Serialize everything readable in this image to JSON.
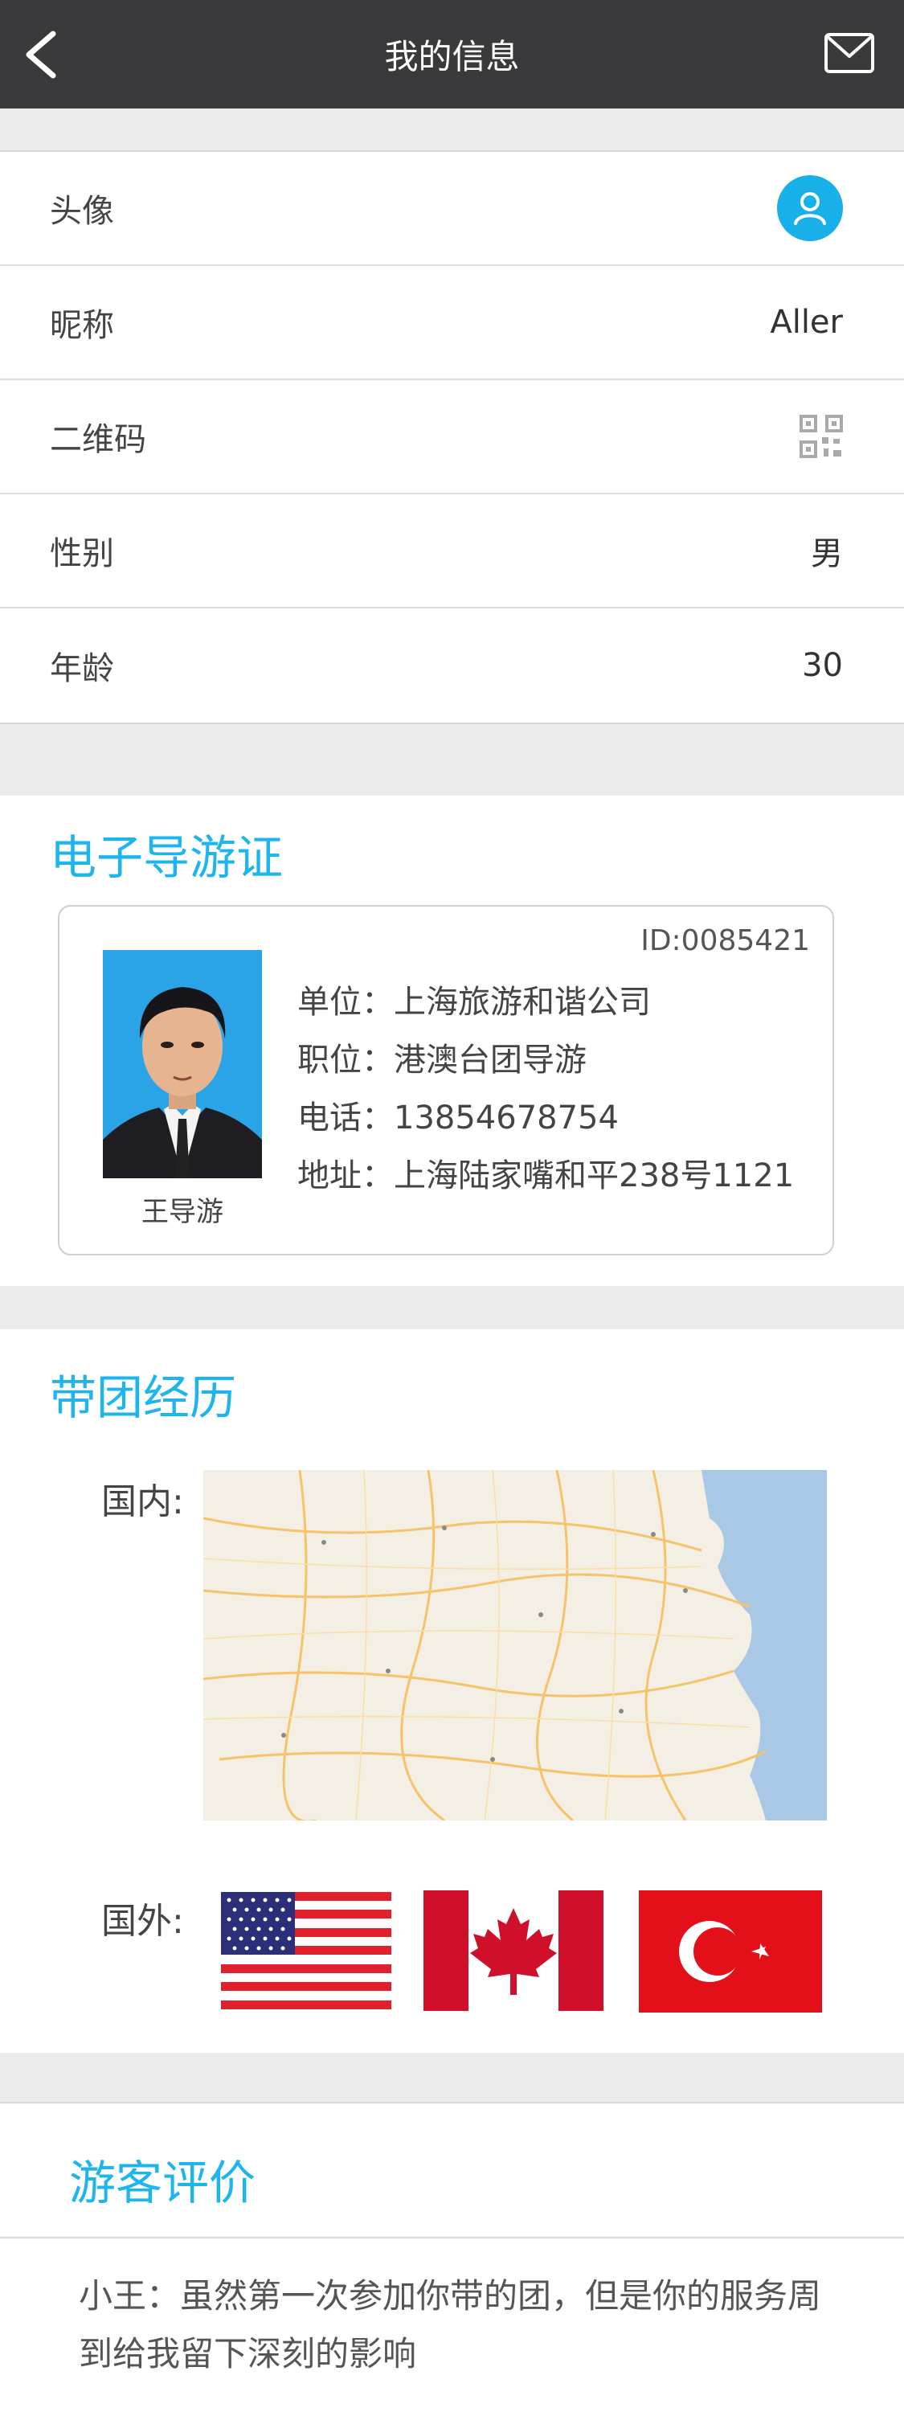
{
  "header": {
    "title": "我的信息",
    "back_icon": "chevron-left-icon",
    "mail_icon": "mail-icon"
  },
  "profile": {
    "avatar_label": "头像",
    "nickname_label": "昵称",
    "nickname_value": "Aller",
    "qrcode_label": "二维码",
    "gender_label": "性别",
    "gender_value": "男",
    "age_label": "年龄",
    "age_value": "30"
  },
  "guide_license": {
    "title": "电子导游证",
    "id": "ID:0085421",
    "name": "王导游",
    "unit": "单位：上海旅游和谐公司",
    "position": "职位：港澳台团导游",
    "phone": "电话：13854678754",
    "address": "地址：上海陆家嘴和平238号1121"
  },
  "experience": {
    "title": "带团经历",
    "domestic_label": "国内:",
    "abroad_label": "国外:",
    "flags": [
      "usa-flag",
      "canada-flag",
      "turkey-flag"
    ]
  },
  "review": {
    "title": "游客评价",
    "text": "小王：虽然第一次参加你带的团，但是你的服务周到给我留下深刻的影响"
  },
  "colors": {
    "accent": "#1eb5ee",
    "header_bg": "#3a3a3c"
  }
}
